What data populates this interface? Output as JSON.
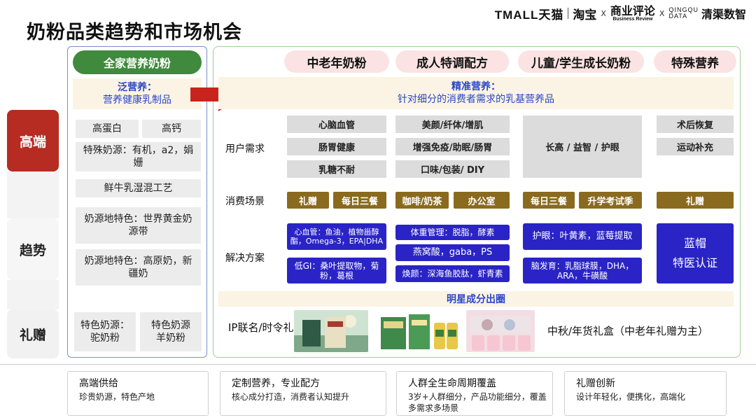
{
  "page": {
    "title": "奶粉品类趋势和市场机会"
  },
  "logos": {
    "tmall": "TMALL天猫",
    "taobao": "淘宝",
    "x1": "X",
    "sbr_cn": "商业评论",
    "sbr_en": "Business Review",
    "x2": "X",
    "qingqu_en_1": "QINGQU",
    "qingqu_en_2": "DATA",
    "qingqu_cn": "清渠数智"
  },
  "row_labels": {
    "high_end": "高端",
    "trend": "趋势",
    "gift": "礼赠"
  },
  "left_panel": {
    "family": "全家营养奶粉",
    "general_title": "泛营养：",
    "general_sub": "营养健康乳制品",
    "high_end_items": [
      "高蛋白",
      "高钙",
      "特殊奶源：有机，a2，娟姗"
    ],
    "trend_items": [
      "鲜牛乳湿混工艺",
      "奶源地特色：世界黄金奶源带",
      "奶源地特色：高原奶，新疆奶"
    ],
    "gift_items": [
      "特色奶源：驼奶粉",
      "特色奶源羊奶粉"
    ]
  },
  "segments": [
    "中老年奶粉",
    "成人特调配方",
    "儿童/学生成长奶粉",
    "特殊营养"
  ],
  "precise": {
    "title": "精准营养：",
    "sub": "针对细分的消费者需求的乳基营养品"
  },
  "section_labels": {
    "needs": "用户需求",
    "scenes": "消费场景",
    "solutions": "解决方案",
    "gift": "IP联名/时令礼盒"
  },
  "needs": {
    "seg1": [
      "心脑血管",
      "肠胃健康",
      "乳糖不耐"
    ],
    "seg2": [
      "美颜/纤体/增肌",
      "增强免疫/助眠/肠胃",
      "口味/包装/ DIY"
    ],
    "seg3": "长高 / 益智 / 护眼",
    "seg4": [
      "术后恢复",
      "运动补充"
    ]
  },
  "scenes": [
    "礼赠",
    "每日三餐",
    "咖啡/奶茶",
    "办公室",
    "每日三餐",
    "升学考试季",
    "礼赠"
  ],
  "solutions": {
    "seg1": [
      "心血管：鱼油，植物甾醇酯，Omega-3，EPA|DHA",
      "低GI：桑叶提取物，菊粉，葛根"
    ],
    "seg2": [
      "体重管理：脱脂，酵素",
      "燕窝酸，gaba，PS",
      "焕颜：深海鱼胶肽，虾青素"
    ],
    "seg3": [
      "护眼：叶黄素，蓝莓提取",
      "脑发育：乳脂球膜，DHA，ARA，牛磺酸"
    ],
    "seg4": [
      "蓝帽",
      "特医认证"
    ]
  },
  "star_band": "明星成分出圈",
  "gift_note": "中秋/年货礼盒（中老年礼赠为主）",
  "bottom_cards": [
    {
      "title": "高端供给",
      "sub": "珍贵奶源，特色产地"
    },
    {
      "title": "定制营养，专业配方",
      "sub": "核心成分打造，消费者认知提升"
    },
    {
      "title": "人群全生命周期覆盖",
      "sub": "3岁+人群细分，产品功能细分，覆盖多需求多场景"
    },
    {
      "title": "礼赠创新",
      "sub": "设计年轻化，便携化，高端化"
    }
  ],
  "colors": {
    "high_end_red": "#b62b22",
    "family_green": "#3f8a3d",
    "precise_blue": "#2a47c8",
    "solution_blue": "#2a24c6",
    "scene_brown": "#8a6a1f",
    "segment_pink": "#fbe3e3",
    "cream": "#fbf3e3"
  }
}
